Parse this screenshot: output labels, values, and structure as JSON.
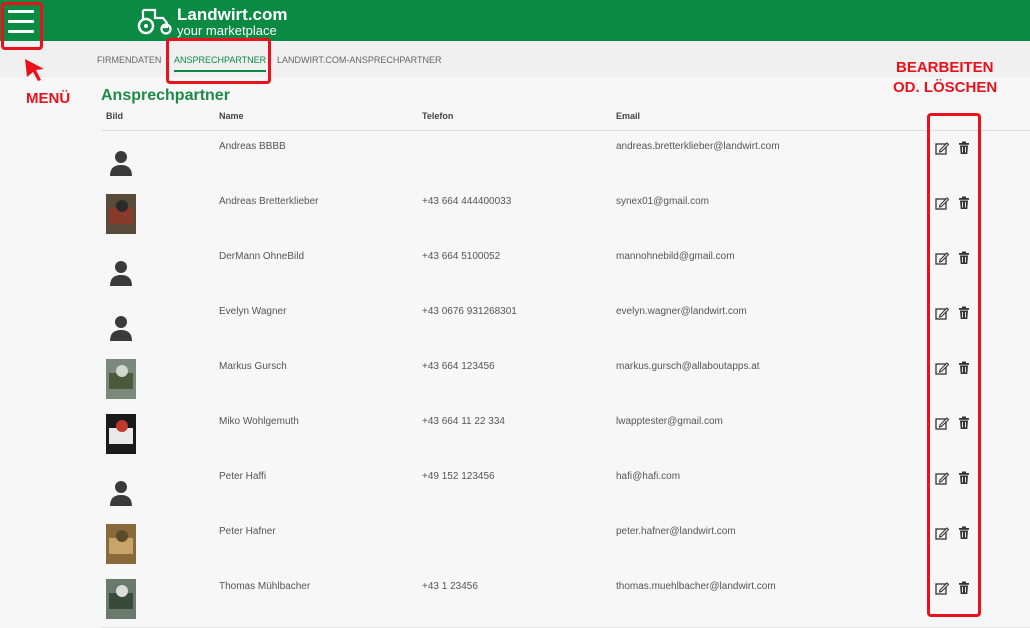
{
  "header": {
    "menu_icon": "hamburger-menu-icon",
    "logo_icon": "tractor-icon",
    "logo_title": "Landwirt.com",
    "logo_subtitle": "your marketplace",
    "bg_color": "#0a8a43"
  },
  "tabs": [
    {
      "label": "FIRMENDATEN",
      "active": false
    },
    {
      "label": "ANSPRECHPARTNER",
      "active": true
    },
    {
      "label": "LANDWIRT.COM-ANSPRECHPARTNER",
      "active": false
    }
  ],
  "main": {
    "title": "Ansprechpartner",
    "columns": {
      "bild": "Bild",
      "name": "Name",
      "telefon": "Telefon",
      "email": "Email"
    },
    "rows": [
      {
        "photo": "avatar-placeholder-icon",
        "name": "Andreas BBBB",
        "phone": "",
        "email": "andreas.bretterklieber@landwirt.com"
      },
      {
        "photo": "photo",
        "name": "Andreas Bretterklieber",
        "phone": "+43 664 444400033",
        "email": "synex01@gmail.com"
      },
      {
        "photo": "avatar-placeholder-icon",
        "name": "DerMann OhneBild",
        "phone": "+43 664 5100052",
        "email": "mannohnebild@gmail.com"
      },
      {
        "photo": "avatar-placeholder-icon",
        "name": "Evelyn Wagner",
        "phone": "+43 0676 931268301",
        "email": "evelyn.wagner@landwirt.com"
      },
      {
        "photo": "photo",
        "name": "Markus Gursch",
        "phone": "+43 664 123456",
        "email": "markus.gursch@allaboutapps.at"
      },
      {
        "photo": "photo",
        "name": "Miko Wohlgemuth",
        "phone": "+43 664 11 22 334",
        "email": "lwapptester@gmail.com"
      },
      {
        "photo": "avatar-placeholder-icon",
        "name": "Peter Haffi",
        "phone": "+49 152 123456",
        "email": "hafi@hafi.com"
      },
      {
        "photo": "photo",
        "name": "Peter Hafner",
        "phone": "",
        "email": "peter.hafner@landwirt.com"
      },
      {
        "photo": "photo",
        "name": "Thomas Mühlbacher",
        "phone": "+43 1 23456",
        "email": "thomas.muehlbacher@landwirt.com"
      }
    ],
    "actions": {
      "edit_icon": "edit-icon",
      "delete_icon": "trash-icon"
    }
  },
  "annotations": {
    "menu_label": "MENÜ",
    "actions_label_line1": "BEARBEITEN",
    "actions_label_line2": "OD. LÖSCHEN",
    "highlight_color": "#e8111c"
  }
}
